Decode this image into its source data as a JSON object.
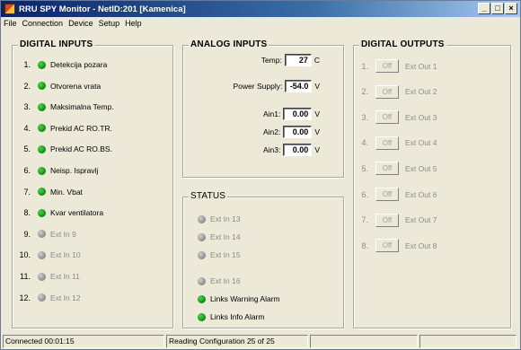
{
  "window": {
    "title": "RRU SPY Monitor - NetID:201 [Kamenica]"
  },
  "menu": [
    "File",
    "Connection",
    "Device",
    "Setup",
    "Help"
  ],
  "digital_inputs": {
    "title": "DIGITAL INPUTS",
    "items": [
      {
        "num": "1.",
        "label": "Detekcija pozara",
        "state": "green"
      },
      {
        "num": "2.",
        "label": "Otvorena vrata",
        "state": "green"
      },
      {
        "num": "3.",
        "label": "Maksimalna Temp.",
        "state": "green"
      },
      {
        "num": "4.",
        "label": "Prekid AC RO.TR.",
        "state": "green"
      },
      {
        "num": "5.",
        "label": "Prekid AC RO.BS.",
        "state": "green"
      },
      {
        "num": "6.",
        "label": "Neisp. Ispravlj",
        "state": "green"
      },
      {
        "num": "7.",
        "label": "Min. Vbat",
        "state": "green"
      },
      {
        "num": "8.",
        "label": "Kvar ventilatora",
        "state": "green"
      },
      {
        "num": "9.",
        "label": "Ext In 9",
        "state": "gray"
      },
      {
        "num": "10.",
        "label": "Ext In 10",
        "state": "gray"
      },
      {
        "num": "11.",
        "label": "Ext In 11",
        "state": "gray"
      },
      {
        "num": "12.",
        "label": "Ext In 12",
        "state": "gray"
      }
    ]
  },
  "analog_inputs": {
    "title": "ANALOG INPUTS",
    "items": [
      {
        "label": "Temp:",
        "value": "27",
        "unit": "C"
      },
      {
        "label": "Power Supply:",
        "value": "-54.0",
        "unit": "V"
      },
      {
        "label": "Ain1:",
        "value": "0.00",
        "unit": "V"
      },
      {
        "label": "Ain2:",
        "value": "0.00",
        "unit": "V"
      },
      {
        "label": "Ain3:",
        "value": "0.00",
        "unit": "V"
      }
    ]
  },
  "status": {
    "title": "STATUS",
    "items": [
      {
        "label": "Ext In 13",
        "state": "gray"
      },
      {
        "label": "Ext In 14",
        "state": "gray"
      },
      {
        "label": "Ext In 15",
        "state": "gray"
      },
      {
        "label": "Ext In 16",
        "state": "gray"
      },
      {
        "label": "Links Warning Alarm",
        "state": "green"
      },
      {
        "label": "Links Info Alarm",
        "state": "green"
      }
    ]
  },
  "digital_outputs": {
    "title": "DIGITAL OUTPUTS",
    "items": [
      {
        "num": "1.",
        "button": "Off",
        "label": "Ext Out 1"
      },
      {
        "num": "2.",
        "button": "Off",
        "label": "Ext Out 2"
      },
      {
        "num": "3.",
        "button": "Off",
        "label": "Ext Out 3"
      },
      {
        "num": "4.",
        "button": "Off",
        "label": "Ext Out 4"
      },
      {
        "num": "5.",
        "button": "Off",
        "label": "Ext Out 5"
      },
      {
        "num": "6.",
        "button": "Off",
        "label": "Ext Out 6"
      },
      {
        "num": "7.",
        "button": "Off",
        "label": "Ext Out 7"
      },
      {
        "num": "8.",
        "button": "Off",
        "label": "Ext Out 8"
      }
    ]
  },
  "statusbar": {
    "connected": "Connected 00:01:15",
    "reading": "Reading Configuration 25 of 25"
  }
}
